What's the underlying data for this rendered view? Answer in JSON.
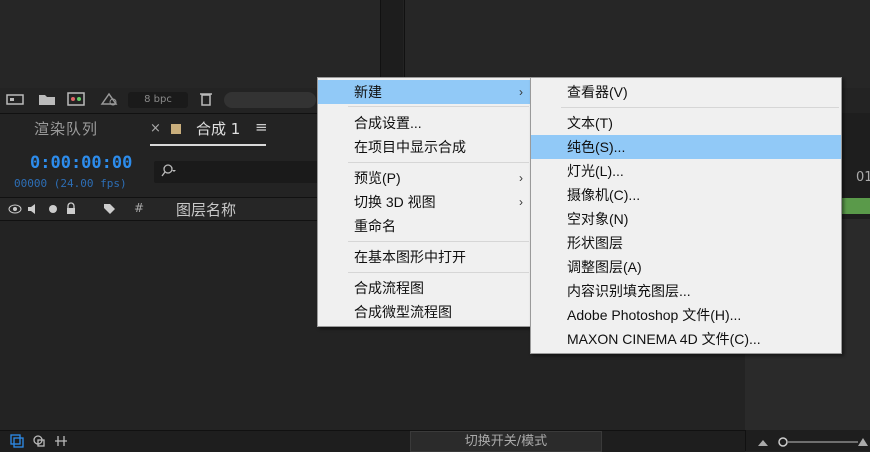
{
  "project_toolbar": {
    "bpc": "8 bpc"
  },
  "timeline": {
    "tab_render": "渲染队列",
    "tab_close": "×",
    "tab_comp": "合成 1",
    "tab_menu": "≡",
    "timecode": "0:00:00:00",
    "frames": "00000 (24.00 fps)",
    "col_hash": "#",
    "col_layer_name": "图层名称",
    "switch_mode": "切换开关/模式",
    "ruler_num": "01"
  },
  "context_menu": {
    "items": [
      {
        "label": "新建",
        "has_submenu": true,
        "highlighted": true
      },
      {
        "label": "合成设置..."
      },
      {
        "label": "在项目中显示合成"
      },
      {
        "label": "预览(P)",
        "has_submenu": true
      },
      {
        "label": "切换 3D 视图",
        "has_submenu": true
      },
      {
        "label": "重命名"
      },
      {
        "label": "在基本图形中打开"
      },
      {
        "label": "合成流程图"
      },
      {
        "label": "合成微型流程图"
      }
    ],
    "arrow": "›"
  },
  "submenu": {
    "items": [
      {
        "label": "查看器(V)"
      },
      {
        "label": "文本(T)"
      },
      {
        "label": "纯色(S)...",
        "highlighted": true
      },
      {
        "label": "灯光(L)..."
      },
      {
        "label": "摄像机(C)..."
      },
      {
        "label": "空对象(N)"
      },
      {
        "label": "形状图层"
      },
      {
        "label": "调整图层(A)"
      },
      {
        "label": "内容识别填充图层..."
      },
      {
        "label": "Adobe Photoshop 文件(H)..."
      },
      {
        "label": "MAXON CINEMA 4D 文件(C)..."
      }
    ]
  },
  "colors": {
    "accent": "#2d8ceb",
    "menu_highlight": "#91c9f7"
  }
}
